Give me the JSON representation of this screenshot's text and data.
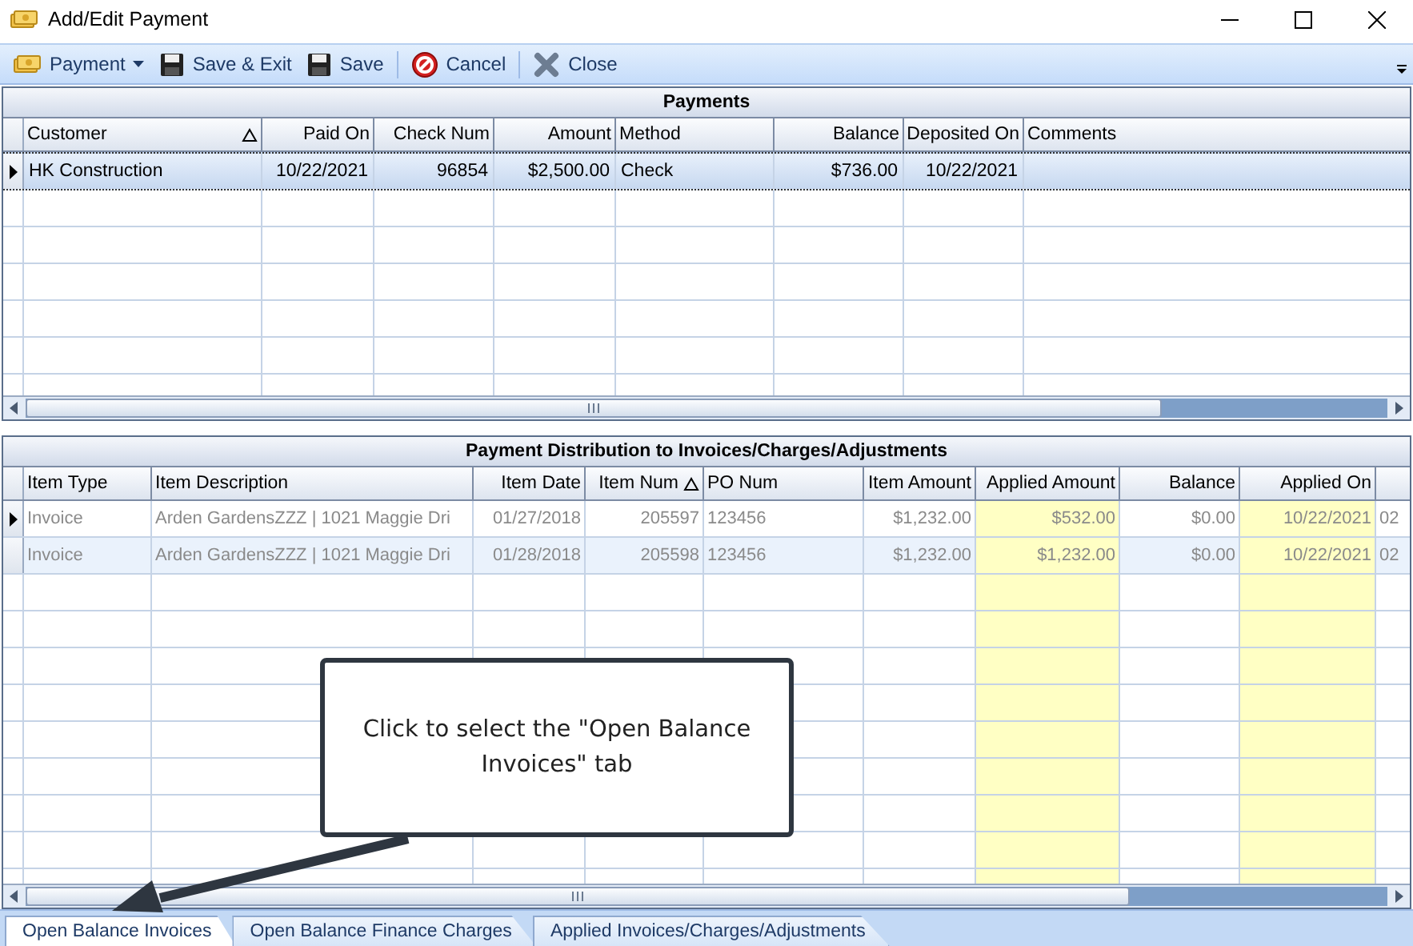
{
  "window": {
    "title": "Add/Edit Payment"
  },
  "toolbar": [
    {
      "kind": "payment",
      "label": "Payment",
      "dropdown": true
    },
    {
      "kind": "save",
      "label": "Save & Exit",
      "dropdown": false
    },
    {
      "kind": "save",
      "label": "Save",
      "dropdown": false
    },
    {
      "kind": "cancel",
      "label": "Cancel",
      "dropdown": false
    },
    {
      "kind": "close",
      "label": "Close",
      "dropdown": false
    }
  ],
  "payments": {
    "title": "Payments",
    "columns": [
      {
        "label": "Customer",
        "sorted": true
      },
      {
        "label": "Paid On",
        "sorted": false
      },
      {
        "label": "Check Num",
        "sorted": false
      },
      {
        "label": "Amount",
        "sorted": false
      },
      {
        "label": "Method",
        "sorted": false
      },
      {
        "label": "Balance",
        "sorted": false
      },
      {
        "label": "Deposited On",
        "sorted": false
      },
      {
        "label": "Comments",
        "sorted": false
      }
    ],
    "rows": [
      {
        "selected": true,
        "cells": [
          "HK Construction",
          "10/22/2021",
          "96854",
          "$2,500.00",
          "Check",
          "$736.00",
          "10/22/2021",
          ""
        ]
      }
    ]
  },
  "distribution": {
    "title": "Payment Distribution to Invoices/Charges/Adjustments",
    "columns": [
      {
        "label": "Item Type",
        "sorted": false,
        "highlight": false
      },
      {
        "label": "Item Description",
        "sorted": false,
        "highlight": false
      },
      {
        "label": "Item Date",
        "sorted": false,
        "highlight": false
      },
      {
        "label": "Item Num",
        "sorted": true,
        "highlight": false
      },
      {
        "label": "PO Num",
        "sorted": false,
        "highlight": false
      },
      {
        "label": "Item Amount",
        "sorted": false,
        "highlight": false
      },
      {
        "label": "Applied Amount",
        "sorted": false,
        "highlight": true
      },
      {
        "label": "Balance",
        "sorted": false,
        "highlight": false
      },
      {
        "label": "Applied On",
        "sorted": false,
        "highlight": true
      },
      {
        "sorted": false,
        "highlight": false
      }
    ],
    "rows": [
      {
        "current": true,
        "cells": [
          "Invoice",
          "Arden GardensZZZ | 1021 Maggie Dri",
          "01/27/2018",
          "205597",
          "123456",
          "$1,232.00",
          "$532.00",
          "$0.00",
          "10/22/2021",
          "02"
        ]
      },
      {
        "current": false,
        "cells": [
          "Invoice",
          "Arden GardensZZZ | 1021 Maggie Dri",
          "01/28/2018",
          "205598",
          "123456",
          "$1,232.00",
          "$1,232.00",
          "$0.00",
          "10/22/2021",
          "02"
        ]
      }
    ]
  },
  "tabs": [
    {
      "label": "Open Balance Invoices",
      "selected": true
    },
    {
      "label": "Open Balance Finance Charges",
      "selected": false
    },
    {
      "label": "Applied Invoices/Charges/Adjustments",
      "selected": false
    }
  ],
  "callout": {
    "text": "Click to select the \"Open Balance Invoices\" tab"
  }
}
